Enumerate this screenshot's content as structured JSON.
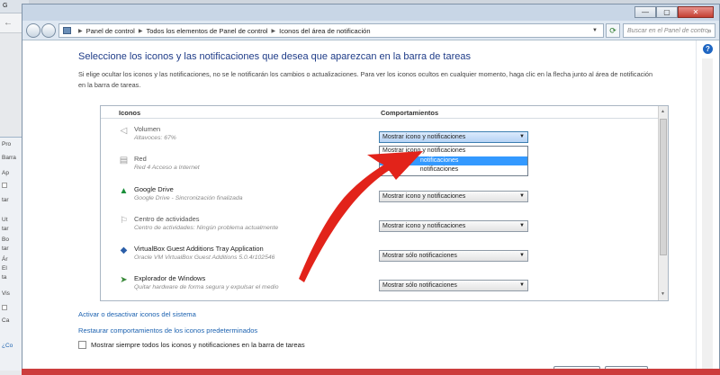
{
  "background_browser": {
    "tab_label": "G",
    "back_arrow": "←"
  },
  "background_window": {
    "fragments": [
      "Pro",
      "Barra",
      "Ap",
      "tar",
      "Ut",
      "tar",
      "Bo",
      "tar",
      "Ár",
      "El",
      "ta",
      "Vis",
      "Ca",
      "¿Co"
    ]
  },
  "window": {
    "controls": {
      "minimize": "—",
      "maximize": "▢",
      "close": "✕"
    },
    "address": {
      "crumbs": [
        "Panel de control",
        "Todos los elementos de Panel de control",
        "Iconos del área de notificación"
      ]
    },
    "search_placeholder": "Buscar en el Panel de contro",
    "help_label": "?"
  },
  "page": {
    "heading": "Seleccione los iconos y las notificaciones que desea que aparezcan en la barra de tareas",
    "description": "Si elige ocultar los iconos y las notificaciones, no se le notificarán los cambios o actualizaciones. Para ver los iconos ocultos en cualquier momento, haga clic en la flecha junto al área de notificación en la barra de tareas."
  },
  "table": {
    "col_icons": "Iconos",
    "col_behaviors": "Comportamientos",
    "rows": [
      {
        "name": "Volumen",
        "sub": "Altavoces: 67%",
        "behavior": "Mostrar icono y notificaciones"
      },
      {
        "name": "Red",
        "sub": "Red 4 Acceso a Internet",
        "behavior": "Mostrar icono y notificaciones"
      },
      {
        "name": "Google Drive",
        "sub": "Google Drive - Sincronización finalizada",
        "behavior": "Mostrar icono y notificaciones"
      },
      {
        "name": "Centro de actividades",
        "sub": "Centro de actividades: Ningún problema actualmente",
        "behavior": "Mostrar icono y notificaciones"
      },
      {
        "name": "VirtualBox Guest Additions Tray Application",
        "sub": "Oracle VM VirtualBox Guest Additions 5.0.4r102546",
        "behavior": "Mostrar sólo notificaciones"
      },
      {
        "name": "Explorador de Windows",
        "sub": "Quitar hardware de forma segura y expulsar el medio",
        "behavior": "Mostrar sólo notificaciones"
      }
    ],
    "dropdown_options": [
      "Mostrar icono y notificaciones",
      "Ocultar icono y notificaciones",
      "Mostrar sólo notificaciones"
    ],
    "dropdown_visible": [
      "Mostrar icono y notificaciones",
      "notificaciones",
      "Mo",
      "notificaciones"
    ],
    "highlighted_option_index": 1
  },
  "links": {
    "toggle_system_icons": "Activar o desactivar iconos del sistema",
    "restore_defaults": "Restaurar comportamientos de los iconos predeterminados"
  },
  "checkbox": {
    "label": "Mostrar siempre todos los iconos y notificaciones en la barra de tareas",
    "checked": false
  },
  "buttons": {
    "accept": "Aceptar",
    "cancel": "Cancelar"
  },
  "colors": {
    "heading": "#1f3c88",
    "link": "#1c62b0",
    "highlight": "#3399ff",
    "arrow": "#e2231a",
    "taskbar": "#cc3d3d"
  },
  "icons": [
    "volume-icon",
    "network-icon",
    "google-drive-icon",
    "action-center-flag-icon",
    "virtualbox-icon",
    "safely-remove-hardware-icon",
    "help-icon",
    "search-icon",
    "refresh-icon",
    "red-arrow-annotation"
  ]
}
